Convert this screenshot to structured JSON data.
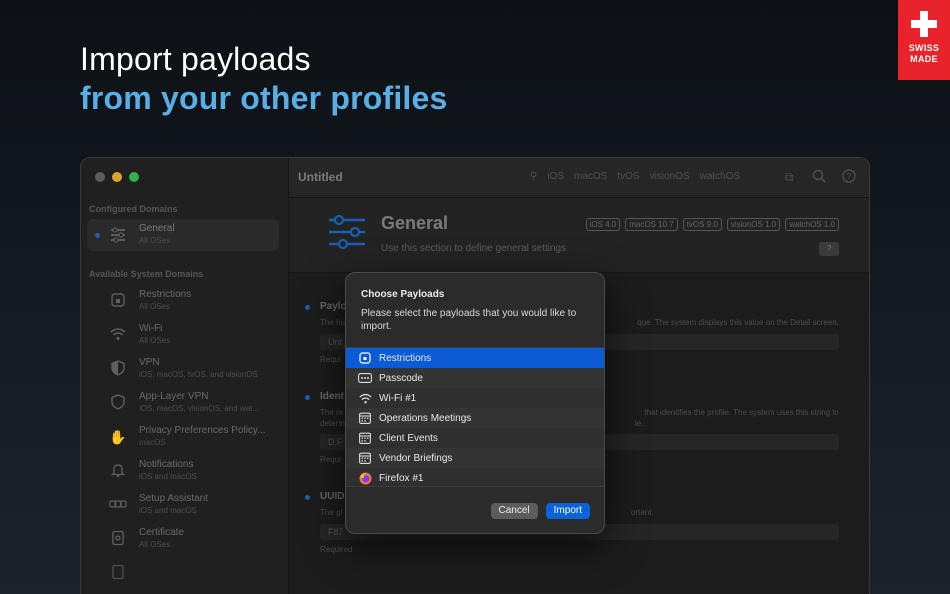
{
  "headline": {
    "line1": "Import payloads",
    "line2": "from your other profiles"
  },
  "badge": {
    "line1": "SWISS",
    "line2": "MADE"
  },
  "window": {
    "title": "Untitled",
    "platforms": [
      "iOS",
      "macOS",
      "tvOS",
      "visionOS",
      "watchOS"
    ]
  },
  "sidebar": {
    "configured_header": "Configured Domains",
    "configured": [
      {
        "label": "General",
        "sub": "All OSes",
        "icon": "sliders-icon"
      }
    ],
    "available_header": "Available System Domains",
    "available": [
      {
        "label": "Restrictions",
        "sub": "All OSes",
        "icon": "lock-icon"
      },
      {
        "label": "Wi-Fi",
        "sub": "All OSes",
        "icon": "wifi-icon"
      },
      {
        "label": "VPN",
        "sub": "iOS, macOS, tvOS, and visionOS",
        "icon": "shield-icon"
      },
      {
        "label": "App-Layer VPN",
        "sub": "iOS, macOS, visionOS, and wat...",
        "icon": "shield-icon"
      },
      {
        "label": "Privacy Preferences Policy...",
        "sub": "macOS",
        "icon": "hand-icon"
      },
      {
        "label": "Notifications",
        "sub": "iOS and macOS",
        "icon": "bell-icon"
      },
      {
        "label": "Setup Assistant",
        "sub": "iOS and macOS",
        "icon": "dots-icon"
      },
      {
        "label": "Certificate",
        "sub": "All OSes",
        "icon": "certificate-icon"
      },
      {
        "label": "",
        "sub": "",
        "icon": "document-icon"
      }
    ]
  },
  "general": {
    "title": "General",
    "description": "Use this section to define general settings",
    "versions": [
      "iOS 4.0",
      "macOS 10.7",
      "tvOS 9.0",
      "visionOS 1.0",
      "watchOS 1.0"
    ],
    "help_label": "?"
  },
  "fields": [
    {
      "name": "Paylo",
      "desc": "The hu",
      "desc_right": "que. The system displays this value on the Detail screen.",
      "value": "Unt",
      "req": "Requi"
    },
    {
      "name": "Ident",
      "desc": "The re",
      "desc2": "determ",
      "desc_right": "that identifies the profile. The system uses this string to",
      "desc_right2": "le.",
      "value": "D.F",
      "req": "Requi"
    },
    {
      "name": "UUID",
      "desc": "The gl",
      "desc_right": "ortant.",
      "value": "F87",
      "req": "Required"
    }
  ],
  "dialog": {
    "title": "Choose Payloads",
    "message": "Please select the payloads that you would like to import.",
    "payloads": [
      {
        "label": "Restrictions",
        "icon": "lock-icon",
        "selected": true
      },
      {
        "label": "Passcode",
        "icon": "passcode-icon",
        "selected": false
      },
      {
        "label": "Wi-Fi #1",
        "icon": "wifi-icon",
        "selected": false
      },
      {
        "label": "Operations Meetings",
        "icon": "calendar-icon",
        "selected": false
      },
      {
        "label": "Client Events",
        "icon": "calendar-icon",
        "selected": false
      },
      {
        "label": "Vendor Briefings",
        "icon": "calendar-icon",
        "selected": false
      },
      {
        "label": "Firefox #1",
        "icon": "firefox-icon",
        "selected": false
      }
    ],
    "cancel_label": "Cancel",
    "import_label": "Import"
  },
  "colors": {
    "accent": "#0a5bd4",
    "headline_blue": "#5aaee6",
    "badge_red": "#e8232c"
  }
}
